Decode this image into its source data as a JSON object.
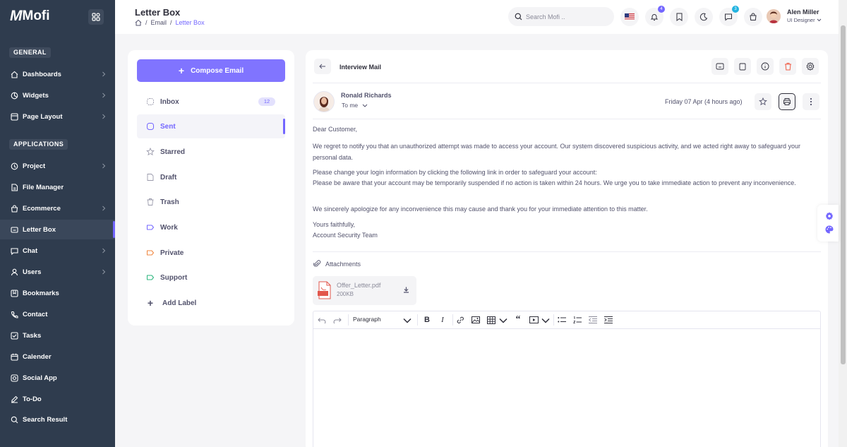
{
  "app": {
    "logo_mark": "M",
    "logo_text": "Mofi"
  },
  "sidebar": {
    "sections": [
      {
        "label": "GENERAL"
      },
      {
        "label": "APPLICATIONS"
      }
    ],
    "items": [
      {
        "label": "Dashboards",
        "icon": "home-icon",
        "has_chevron": true
      },
      {
        "label": "Widgets",
        "icon": "widget-icon",
        "has_chevron": true
      },
      {
        "label": "Page Layout",
        "icon": "layout-icon",
        "has_chevron": true
      },
      {
        "label": "Project",
        "icon": "project-icon",
        "has_chevron": true
      },
      {
        "label": "File Manager",
        "icon": "file-icon",
        "has_chevron": false
      },
      {
        "label": "Ecommerce",
        "icon": "cart-icon",
        "has_chevron": true
      },
      {
        "label": "Letter Box",
        "icon": "mail-icon",
        "has_chevron": false,
        "active": true
      },
      {
        "label": "Chat",
        "icon": "chat-icon",
        "has_chevron": true
      },
      {
        "label": "Users",
        "icon": "user-icon",
        "has_chevron": true
      },
      {
        "label": "Bookmarks",
        "icon": "bookmark-icon",
        "has_chevron": false
      },
      {
        "label": "Contact",
        "icon": "phone-icon",
        "has_chevron": false
      },
      {
        "label": "Tasks",
        "icon": "tasks-icon",
        "has_chevron": false
      },
      {
        "label": "Calender",
        "icon": "calendar-icon",
        "has_chevron": false
      },
      {
        "label": "Social App",
        "icon": "social-icon",
        "has_chevron": false
      },
      {
        "label": "To-Do",
        "icon": "todo-icon",
        "has_chevron": false
      },
      {
        "label": "Search Result",
        "icon": "search-icon",
        "has_chevron": false
      }
    ]
  },
  "header": {
    "title": "Letter Box",
    "breadcrumb": [
      "Email",
      "Letter Box"
    ],
    "search_placeholder": "Search Mofi ..",
    "notification_count": "4",
    "cart_count": "3",
    "user": {
      "name": "Alen Miller",
      "role": "UI Designer"
    }
  },
  "mail_nav": {
    "compose_label": "Compose Email",
    "items": [
      {
        "label": "Inbox",
        "count": "12"
      },
      {
        "label": "Sent",
        "active": true
      },
      {
        "label": "Starred"
      },
      {
        "label": "Draft"
      },
      {
        "label": "Trash"
      },
      {
        "label": "Work",
        "color": "#7366ff"
      },
      {
        "label": "Private",
        "color": "#f0853c"
      },
      {
        "label": "Support",
        "color": "#2ab57d"
      }
    ],
    "add_label": "Add Label"
  },
  "mail": {
    "subject": "Interview Mail",
    "sender": "Ronald Richards",
    "to": "To me",
    "date": "Friday 07 Apr (4 hours ago)",
    "greeting": "Dear Customer,",
    "p1": "We regret to notify you that an unauthorized attempt was made to access your account. Our system discovered suspicious activity, and we acted right away to safeguard your personal data.",
    "p2a": "Please change your login information by clicking the following link in order to safeguard your account:",
    "p2b": "Please be aware that your account may be temporarily suspended if no action is taken within 24 hours. We urge you to take immediate action to prevent any inconvenience.",
    "p3": "We sincerely apologize for any inconvenience this may cause and thank you for your immediate attention to this matter.",
    "sign1": "Yours faithfully,",
    "sign2": "Account Security Team",
    "attachments_label": "Attachments",
    "attachment": {
      "name": "Offer_Letter.pdf",
      "size": "200KB"
    }
  },
  "editor": {
    "format_value": "Paragraph"
  },
  "colors": {
    "accent": "#7366ff",
    "sidebar": "#2f3c4e",
    "danger": "#f05c45"
  }
}
